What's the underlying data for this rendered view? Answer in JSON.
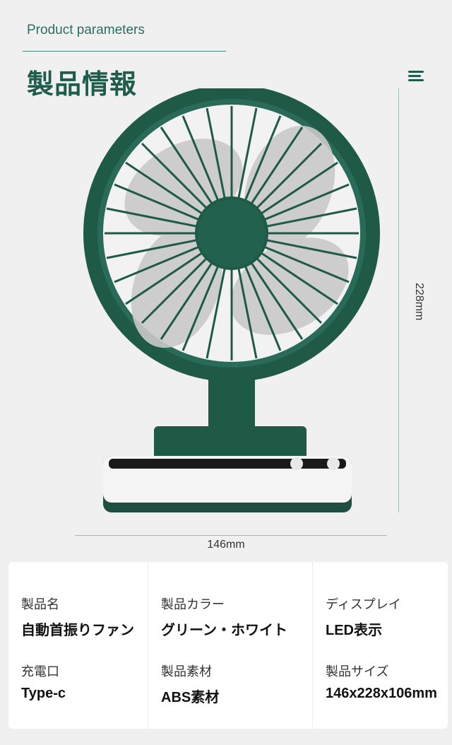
{
  "header": {
    "title_en": "Product parameters",
    "title_jp": "製品情報"
  },
  "dimensions": {
    "height_label": "228mm",
    "width_label": "146mm"
  },
  "colors": {
    "fan_green": "#1f5a47",
    "accent": "#2f6e5e",
    "blade": "#bfbfbf"
  },
  "icons": [
    "menu-icon"
  ],
  "params": {
    "product_name": {
      "label": "製品名",
      "value": "自動首振りファン"
    },
    "product_color": {
      "label": "製品カラー",
      "value": "グリーン・ホワイト"
    },
    "display": {
      "label": "ディスプレイ",
      "value": "LED表示"
    },
    "charging_port": {
      "label": "充電口",
      "value": "Type-c"
    },
    "material": {
      "label": "製品素材",
      "value": "ABS素材"
    },
    "size": {
      "label": "製品サイズ",
      "value": "146x228x106mm"
    }
  }
}
